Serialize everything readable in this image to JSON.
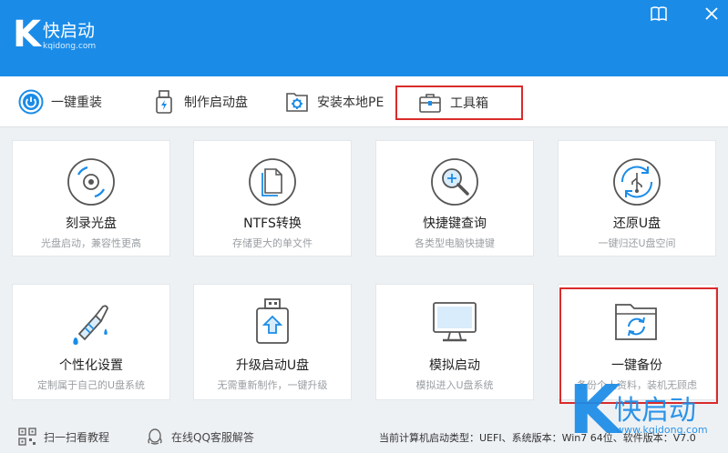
{
  "app": {
    "logo_letter": "K",
    "logo_name": "快启动",
    "logo_domain": "kqidong.com"
  },
  "tabs": [
    {
      "label": "一键重装",
      "icon": "power-icon"
    },
    {
      "label": "制作启动盘",
      "icon": "usb-drive-icon"
    },
    {
      "label": "安装本地PE",
      "icon": "pe-install-icon"
    },
    {
      "label": "工具箱",
      "icon": "toolbox-icon",
      "selected": true
    }
  ],
  "tools": [
    {
      "title": "刻录光盘",
      "sub": "光盘启动，兼容性更高",
      "icon": "cd-disc-icon"
    },
    {
      "title": "NTFS转换",
      "sub": "存储更大的单文件",
      "icon": "ntfs-convert-icon"
    },
    {
      "title": "快捷键查询",
      "sub": "各类型电脑快捷键",
      "icon": "magnifier-icon"
    },
    {
      "title": "还原U盘",
      "sub": "一键归还U盘空间",
      "icon": "restore-usb-icon"
    },
    {
      "title": "个性化设置",
      "sub": "定制属于自己的U盘系统",
      "icon": "paint-brush-icon"
    },
    {
      "title": "升级启动U盘",
      "sub": "无需重新制作，一键升级",
      "icon": "upgrade-usb-icon"
    },
    {
      "title": "模拟启动",
      "sub": "模拟进入U盘系统",
      "icon": "monitor-icon"
    },
    {
      "title": "一键备份",
      "sub": "备份个人资料，装机无顾虑",
      "icon": "backup-folder-icon"
    }
  ],
  "footer": {
    "scan": "扫一扫看教程",
    "qq": "在线QQ客服解答",
    "info": "当前计算机启动类型：UEFI、系统版本：Win7 64位、软件版本：V7.0"
  },
  "watermark": {
    "letter": "K",
    "name": "快启动",
    "domain": "www.kqidong.com"
  },
  "colors": {
    "brand_blue": "#1a8ce8",
    "highlight_red": "#d92b2b"
  }
}
